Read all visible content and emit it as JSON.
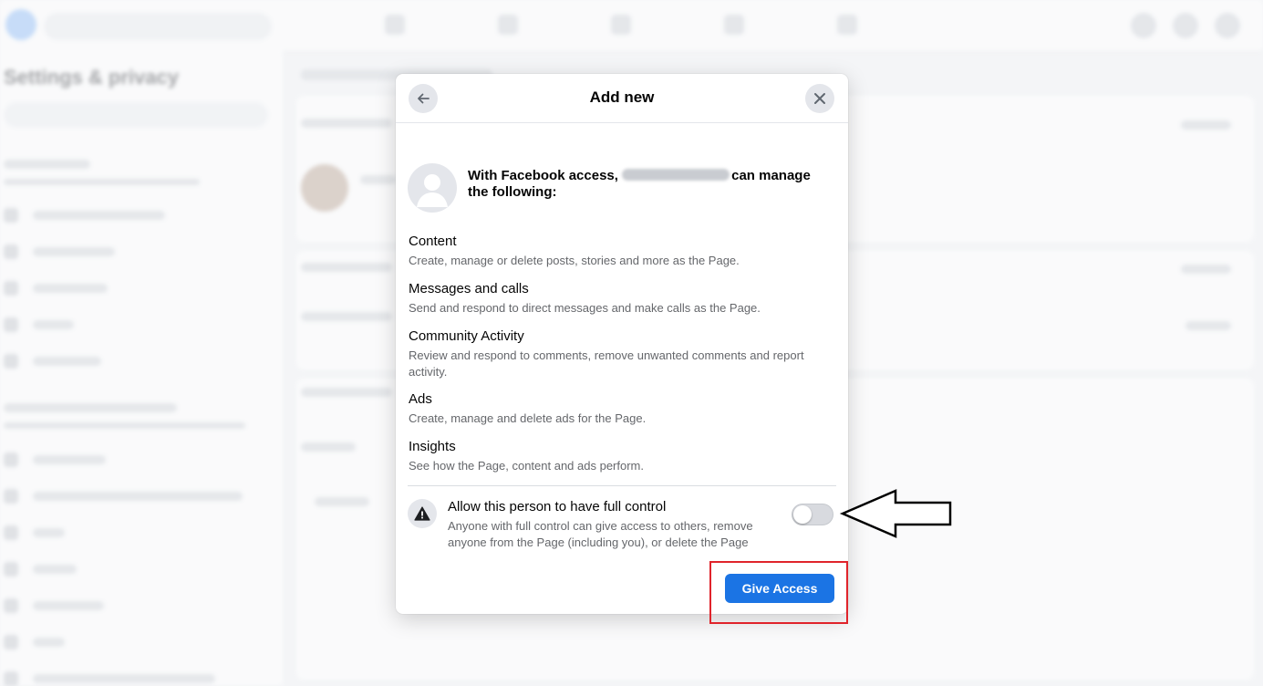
{
  "modal": {
    "title": "Add new",
    "intro_prefix": "With Facebook access,",
    "intro_suffix": "can manage the following:",
    "permissions": [
      {
        "title": "Content",
        "description": "Create, manage or delete posts, stories and more as the Page."
      },
      {
        "title": "Messages and calls",
        "description": "Send and respond to direct messages and make calls as the Page."
      },
      {
        "title": "Community Activity",
        "description": "Review and respond to comments, remove unwanted comments and report activity."
      },
      {
        "title": "Ads",
        "description": "Create, manage and delete ads for the Page."
      },
      {
        "title": "Insights",
        "description": "See how the Page, content and ads perform."
      }
    ],
    "full_control": {
      "title": "Allow this person to have full control",
      "description": "Anyone with full control can give access to others, remove anyone from the Page (including you), or delete the Page",
      "enabled": false
    },
    "give_access_label": "Give Access",
    "icons": {
      "back": "back-arrow-icon",
      "close": "close-icon",
      "warning": "warning-icon",
      "avatar": "default-avatar-icon"
    }
  },
  "background": {
    "sidebar_title": "Settings & privacy"
  },
  "colors": {
    "accent": "#1b74e4",
    "annotation": "#e0242b"
  }
}
